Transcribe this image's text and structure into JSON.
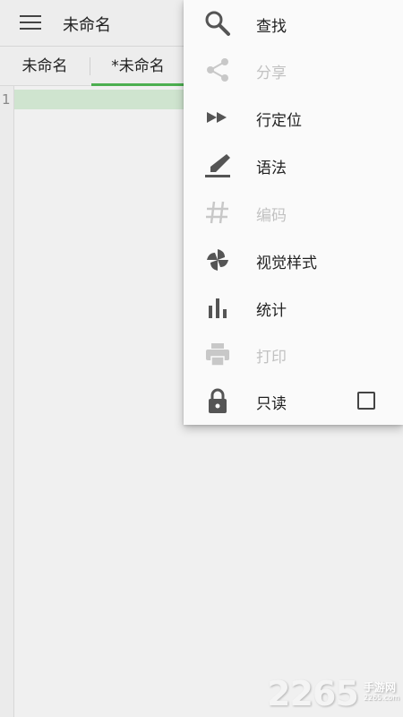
{
  "appbar": {
    "title": "未命名",
    "menu_icon": "hamburger-menu-icon"
  },
  "tabs": [
    {
      "label": "未命名",
      "active": false
    },
    {
      "label": "*未命名",
      "active": true
    }
  ],
  "editor": {
    "line_numbers": [
      "1"
    ],
    "current_line_color": "#cfe4cf"
  },
  "menu": {
    "items": [
      {
        "label": "查找",
        "icon": "search-icon",
        "enabled": true
      },
      {
        "label": "分享",
        "icon": "share-icon",
        "enabled": false
      },
      {
        "label": "行定位",
        "icon": "fast-forward-icon",
        "enabled": true
      },
      {
        "label": "语法",
        "icon": "highlighter-icon",
        "enabled": true
      },
      {
        "label": "编码",
        "icon": "hash-icon",
        "enabled": false
      },
      {
        "label": "视觉样式",
        "icon": "pinwheel-icon",
        "enabled": true
      },
      {
        "label": "统计",
        "icon": "bar-chart-icon",
        "enabled": true
      },
      {
        "label": "打印",
        "icon": "printer-icon",
        "enabled": false
      },
      {
        "label": "只读",
        "icon": "lock-icon",
        "enabled": true,
        "checked": false
      }
    ]
  },
  "watermark": {
    "number": "2265",
    "text": "手游网",
    "domain": "2265.com"
  },
  "colors": {
    "accent": "#4caf50",
    "icon": "#555555",
    "disabled": "#c2c2c2",
    "menu_bg": "#fafafa"
  }
}
